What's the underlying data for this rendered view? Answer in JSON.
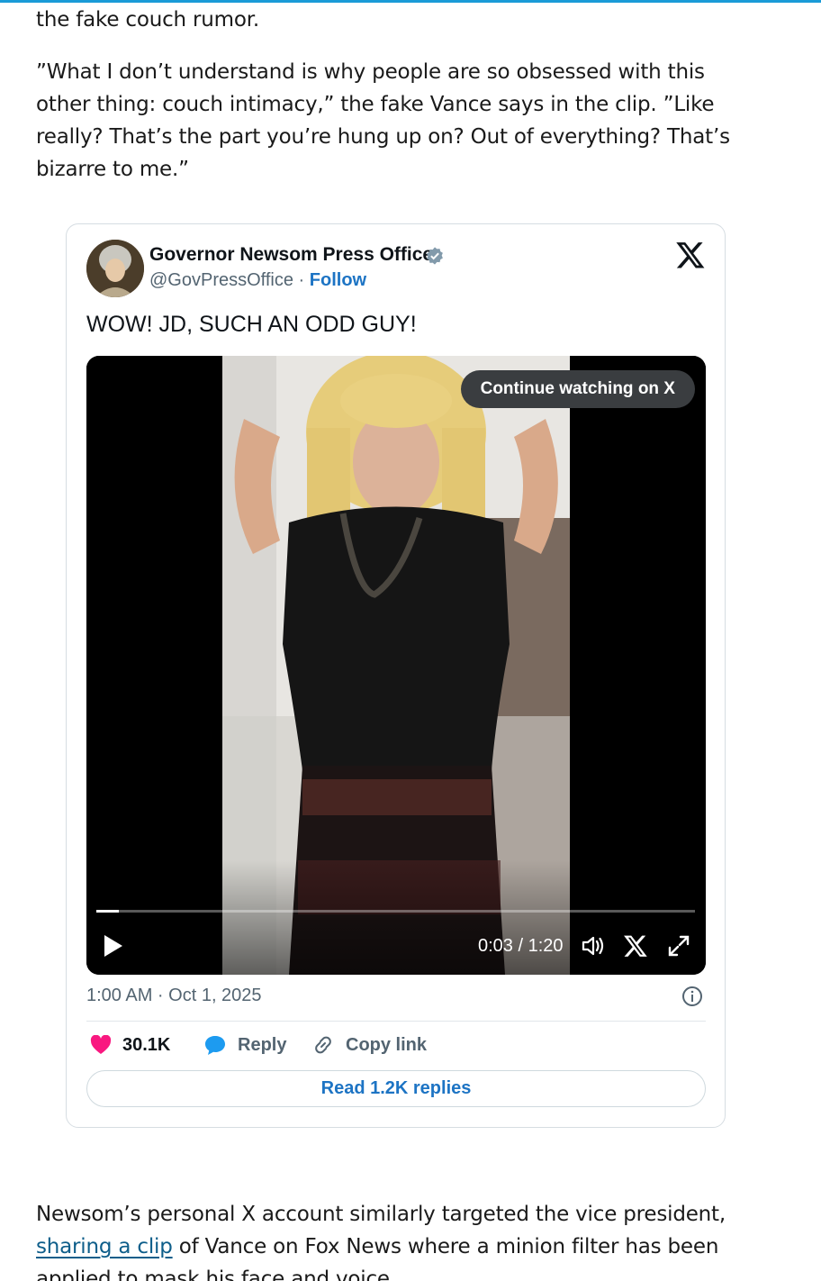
{
  "article": {
    "p1": "the fake couch rumor.",
    "p2": "”What I don’t understand is why people are so obsessed with this other thing: couch intimacy,” the fake Vance says in the clip. ”Like really? That’s the part you’re hung up on? Out of everything? That’s bizarre to me.”",
    "p3_before": "Newsom’s personal X account similarly targeted the vice president, ",
    "p3_link": "sharing a clip",
    "p3_after": " of Vance on Fox News where a minion filter has been applied to mask his face and voice."
  },
  "tweet": {
    "author_name": "Governor Newsom Press Office",
    "handle": "@GovPressOffice",
    "separator": " · ",
    "follow_label": "Follow",
    "text": "WOW! JD, SUCH AN ODD GUY!",
    "video": {
      "continue_label": "Continue watching on X",
      "time": "0:03 / 1:20",
      "progress": 0.0375
    },
    "timestamp": "1:00 AM · Oct 1, 2025",
    "likes": "30.1K",
    "reply_label": "Reply",
    "copy_link_label": "Copy link",
    "read_replies_label": "Read 1.2K replies"
  },
  "colors": {
    "accent": "#1d74c4",
    "like": "#f91880",
    "reply_icon": "#1d9bf0",
    "link": "#0e5e8a"
  },
  "icons": [
    "verified-badge-icon",
    "x-logo-icon",
    "play-icon",
    "volume-icon",
    "fullscreen-icon",
    "info-icon",
    "heart-icon",
    "reply-bubble-icon",
    "link-icon"
  ]
}
